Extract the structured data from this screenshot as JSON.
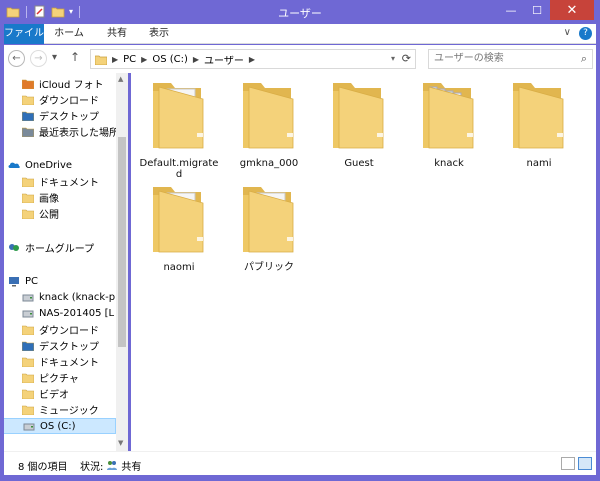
{
  "window": {
    "title": "ユーザー"
  },
  "titlebar": {
    "minimize": "—",
    "maximize": "☐",
    "close": "✕"
  },
  "ribbon": {
    "tabs": [
      "ファイル",
      "ホーム",
      "共有",
      "表示"
    ],
    "expand": "∨",
    "help": "?"
  },
  "address": {
    "back": "←",
    "forward": "→",
    "recent": "▾",
    "up": "↑",
    "crumbs": [
      "PC",
      "OS (C:)",
      "ユーザー"
    ],
    "search_placeholder": "ユーザーの検索"
  },
  "nav": {
    "items": [
      {
        "label": "iCloud フォト",
        "icon": "photos-icon"
      },
      {
        "label": "ダウンロード",
        "icon": "download-folder-icon"
      },
      {
        "label": "デスクトップ",
        "icon": "desktop-icon"
      },
      {
        "label": "最近表示した場所",
        "icon": "recent-places-icon"
      },
      {
        "label": "OneDrive",
        "icon": "onedrive-icon"
      },
      {
        "label": "ドキュメント",
        "icon": "folder-icon"
      },
      {
        "label": "画像",
        "icon": "folder-icon"
      },
      {
        "label": "公開",
        "icon": "folder-icon"
      },
      {
        "label": "ホームグループ",
        "icon": "homegroup-icon"
      },
      {
        "label": "PC",
        "icon": "pc-icon"
      },
      {
        "label": "knack (knack-p",
        "icon": "network-drive-icon"
      },
      {
        "label": "NAS-201405 [L",
        "icon": "network-drive-icon"
      },
      {
        "label": "ダウンロード",
        "icon": "download-folder-icon"
      },
      {
        "label": "デスクトップ",
        "icon": "desktop-icon"
      },
      {
        "label": "ドキュメント",
        "icon": "documents-icon"
      },
      {
        "label": "ピクチャ",
        "icon": "pictures-icon"
      },
      {
        "label": "ビデオ",
        "icon": "videos-icon"
      },
      {
        "label": "ミュージック",
        "icon": "music-icon"
      },
      {
        "label": "OS (C:)",
        "icon": "drive-icon"
      }
    ]
  },
  "folders": [
    {
      "name": "Default.migrated",
      "kind": "doc"
    },
    {
      "name": "gmkna_000",
      "kind": "plain"
    },
    {
      "name": "Guest",
      "kind": "plain"
    },
    {
      "name": "knack",
      "kind": "full"
    },
    {
      "name": "nami",
      "kind": "plain"
    },
    {
      "name": "naomi",
      "kind": "doc"
    },
    {
      "name": "パブリック",
      "kind": "doc"
    }
  ],
  "status": {
    "count": "8 個の項目",
    "state_label": "状況:",
    "state_value": "共有"
  },
  "colors": {
    "accent": "#1979ca",
    "titlebar": "#6f68d4",
    "folder": "#f4d27a",
    "folder_dark": "#e1b64f"
  }
}
